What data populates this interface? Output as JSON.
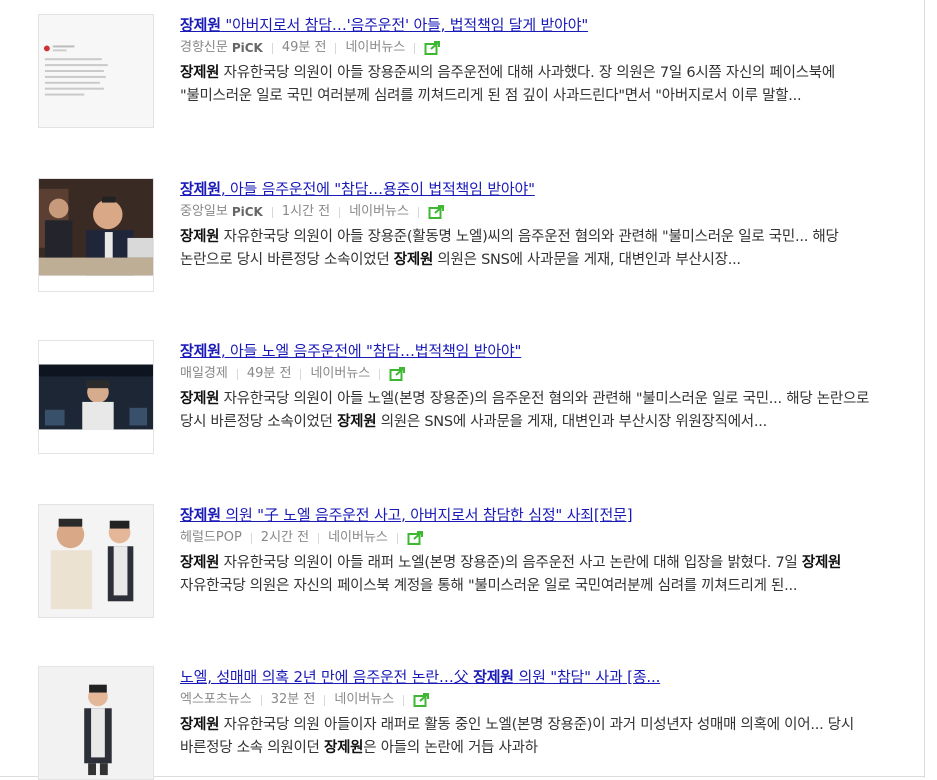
{
  "colors": {
    "link": "#1a1ab8",
    "meta": "#888888",
    "share": "#3eb833",
    "text": "#333333"
  },
  "results": [
    {
      "title_keyword": "장제원",
      "title_rest": " \"아버지로서 참담…'음주운전' 아들, 법적책임 달게 받아야\"",
      "press": "경향신문",
      "pick": "PiCK",
      "time": "49분 전",
      "source": "네이버뉴스",
      "desc_keyword": "장제원",
      "desc_rest": " 자유한국당 의원이 아들 장용준씨의 음주운전에 대해 사과했다. 장 의원은 7일 6시쯤 자신의 페이스북에 \"불미스러운 일로 국민 여러분께 심려를 끼쳐드리게 된 점 깊이 사과드린다\"면서 \"아버지로서 이루 말할...",
      "desc_keyword2": "",
      "desc_tail": "",
      "thumb": "facebook-post-screenshot"
    },
    {
      "title_keyword": "장제원",
      "title_rest": ", 아들 음주운전에 \"참담…용준이 법적책임 받아야\"",
      "press": "중앙일보",
      "pick": "PiCK",
      "time": "1시간 전",
      "source": "네이버뉴스",
      "desc_keyword": "장제원",
      "desc_rest": " 자유한국당 의원이 아들 장용준(활동명 노엘)씨의 음주운전 혐의와 관련해 \"불미스러운 일로 국민... 해당 논란으로 당시 바른정당 소속이었던 ",
      "desc_keyword2": "장제원",
      "desc_tail": " 의원은 SNS에 사과문을 게재, 대변인과 부산시장...",
      "thumb": "politician-photo"
    },
    {
      "title_keyword": "장제원",
      "title_rest": ", 아들 노엘 음주운전에 \"참담…법적책임 받아야\"",
      "press": "매일경제",
      "pick": "",
      "time": "49분 전",
      "source": "네이버뉴스",
      "desc_keyword": "장제원",
      "desc_rest": " 자유한국당 의원이 아들 노엘(본명 장용준)의 음주운전 혐의와 관련해 \"불미스러운 일로 국민... 해당 논란으로 당시 바른정당 소속이었던 ",
      "desc_keyword2": "장제원",
      "desc_tail": " 의원은 SNS에 사과문을 게재, 대변인과 부산시장 위원장직에서...",
      "thumb": "tv-show-still"
    },
    {
      "title_keyword": "장제원",
      "title_rest": " 의원 \"子 노엘 음주운전 사고, 아버지로서 참담한 심정\" 사죄[전문]",
      "press": "헤럴드POP",
      "pick": "",
      "time": "2시간 전",
      "source": "네이버뉴스",
      "desc_keyword": "장제원",
      "desc_rest": " 자유한국당 의원이 아들 래퍼 노엘(본명 장용준)의 음주운전 사고 논란에 대해 입장을 밝혔다. 7일 ",
      "desc_keyword2": "장제원",
      "desc_tail": " 자유한국당 의원은 자신의 페이스북 계정을 통해 \"불미스러운 일로 국민여러분께 심려를 끼쳐드리게 된...",
      "thumb": "two-people-photo"
    },
    {
      "title_keyword": "노엘, 성매매 의혹 2년 만에 음주운전 논란…父 ",
      "title_rest": "장제원",
      "title_tail": " 의원 \"참담\" 사과 [종...",
      "press": "엑스포츠뉴스",
      "pick": "",
      "time": "32분 전",
      "source": "네이버뉴스",
      "desc_keyword": "장제원",
      "desc_rest": " 자유한국당 의원 아들이자 래퍼로 활동 중인 노엘(본명 장용준)이 과거 미성년자 성매매 의혹에 이어... 당시 바른정당 소속 의원이던 ",
      "desc_keyword2": "장제원",
      "desc_tail": "은 아들의 논란에 거듭 사과하",
      "thumb": "person-studio-photo"
    }
  ]
}
